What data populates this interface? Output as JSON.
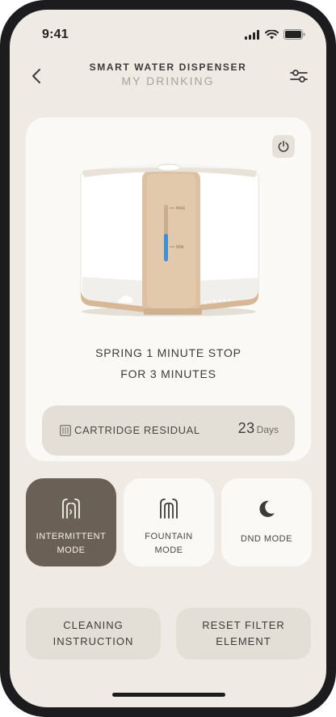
{
  "status_bar": {
    "time": "9:41"
  },
  "header": {
    "title": "SMART WATER DISPENSER",
    "subtitle": "MY DRINKING"
  },
  "device": {
    "max_label": "MAX",
    "min_label": "MIN",
    "water_level": 0.5
  },
  "status": {
    "line1": "SPRING 1 MINUTE STOP",
    "line2": "FOR 3 MINUTES"
  },
  "cartridge": {
    "label": "CARTRIDGE RESIDUAL",
    "value": "23",
    "unit": "Days"
  },
  "modes": [
    {
      "line1": "INTERMITTENT",
      "line2": "MODE",
      "icon": "intermittent-icon",
      "active": true
    },
    {
      "line1": "FOUNTAIN",
      "line2": "MODE",
      "icon": "fountain-icon",
      "active": false
    },
    {
      "line1": "DND MODE",
      "line2": "",
      "icon": "moon-icon",
      "active": false
    }
  ],
  "actions": [
    {
      "line1": "CLEANING",
      "line2": "INSTRUCTION"
    },
    {
      "line1": "RESET FILTER",
      "line2": "ELEMENT"
    }
  ],
  "colors": {
    "background": "#efebe4",
    "card": "#fbf9f5",
    "active_mode": "#6b6055",
    "accent_gold": "#d6b896",
    "water_blue": "#3f8ed8"
  }
}
